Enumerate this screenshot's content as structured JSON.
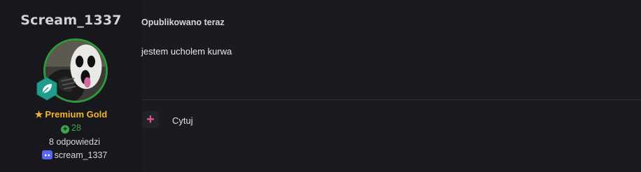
{
  "author": {
    "username": "Scream_1337",
    "group": "Premium Gold",
    "reputation": "28",
    "replies": "8 odpowiedzi",
    "discord": "scream_1337",
    "avatar_icon": "ghostface-avatar",
    "rank_icon": "leaf-badge-icon",
    "colors": {
      "group": "#f2b72a",
      "reputation": "#3aa84a",
      "avatar_ring": "#2e9a3a",
      "rank_badge": "#1f9e8e"
    }
  },
  "post": {
    "posted": "Opublikowano teraz",
    "content": "jestem ucholem kurwa",
    "actions": {
      "plus": "+",
      "quote": "Cytuj"
    },
    "colors": {
      "plus": "#e0529c"
    }
  }
}
